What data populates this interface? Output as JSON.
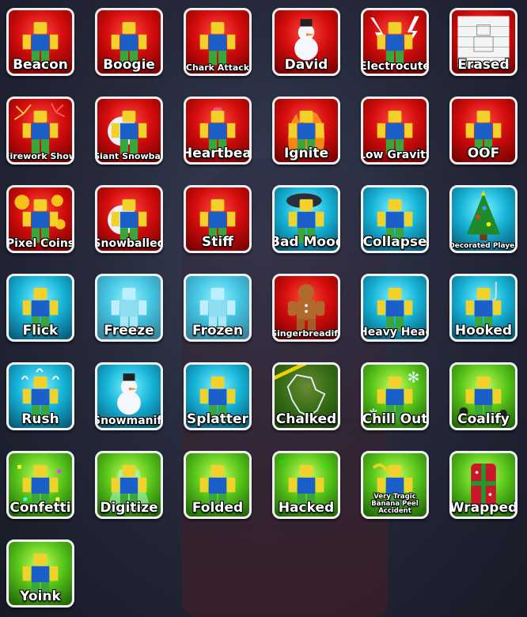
{
  "emotes": [
    {
      "name": "Beacon",
      "tier": "red",
      "icon": "beacon-icon"
    },
    {
      "name": "Boogie",
      "tier": "red",
      "icon": "boogie-icon"
    },
    {
      "name": "Chark Attack",
      "tier": "red",
      "icon": "chark-attack-icon"
    },
    {
      "name": "David",
      "tier": "red",
      "icon": "snowman-icon"
    },
    {
      "name": "Electrocute",
      "tier": "red",
      "icon": "electrocute-icon"
    },
    {
      "name": "Erased",
      "tier": "red",
      "icon": "erased-icon"
    },
    {
      "name": "Firework Show",
      "tier": "red",
      "icon": "firework-icon"
    },
    {
      "name": "Giant Snowball",
      "tier": "red",
      "icon": "giant-snowball-icon"
    },
    {
      "name": "Heartbeat",
      "tier": "red",
      "icon": "heartbeat-icon"
    },
    {
      "name": "Ignite",
      "tier": "red",
      "icon": "fire-icon"
    },
    {
      "name": "Low Gravity",
      "tier": "red",
      "icon": "low-gravity-icon"
    },
    {
      "name": "OOF",
      "tier": "red",
      "icon": "oof-icon"
    },
    {
      "name": "Pixel Coins",
      "tier": "red",
      "icon": "coins-icon"
    },
    {
      "name": "Snowballed",
      "tier": "red",
      "icon": "snowballed-icon"
    },
    {
      "name": "Stiff",
      "tier": "red",
      "icon": "stiff-icon"
    },
    {
      "name": "Bad Mood",
      "tier": "blue",
      "icon": "storm-cloud-icon"
    },
    {
      "name": "Collapse",
      "tier": "blue",
      "icon": "collapse-icon"
    },
    {
      "name": "Decorated Player",
      "tier": "blue",
      "icon": "christmas-tree-icon"
    },
    {
      "name": "Flick",
      "tier": "blue",
      "icon": "flick-icon"
    },
    {
      "name": "Freeze",
      "tier": "blue",
      "icon": "freeze-icon"
    },
    {
      "name": "Frozen",
      "tier": "blue",
      "icon": "frozen-icon"
    },
    {
      "name": "Gingerbreadify",
      "tier": "red",
      "icon": "gingerbread-icon"
    },
    {
      "name": "Heavy Head",
      "tier": "blue",
      "icon": "heavy-head-icon"
    },
    {
      "name": "Hooked",
      "tier": "blue",
      "icon": "hook-icon"
    },
    {
      "name": "Rush",
      "tier": "blue",
      "icon": "rush-icon"
    },
    {
      "name": "Snowmanify",
      "tier": "blue",
      "icon": "snowmanify-icon"
    },
    {
      "name": "Splatter",
      "tier": "blue",
      "icon": "splatter-icon"
    },
    {
      "name": "Chalked",
      "tier": "green",
      "icon": "chalk-outline-icon"
    },
    {
      "name": "Chill Out",
      "tier": "green",
      "icon": "snowflake-icon"
    },
    {
      "name": "Coalify",
      "tier": "green",
      "icon": "coal-icon"
    },
    {
      "name": "Confetti",
      "tier": "green",
      "icon": "confetti-icon"
    },
    {
      "name": "Digitize",
      "tier": "green",
      "icon": "digitize-icon"
    },
    {
      "name": "Folded",
      "tier": "green",
      "icon": "folded-icon"
    },
    {
      "name": "Hacked",
      "tier": "green",
      "icon": "hacked-icon"
    },
    {
      "name": "Very Tragic Banana Peel Accident",
      "tier": "green",
      "icon": "banana-peel-icon"
    },
    {
      "name": "Wrapped",
      "tier": "green",
      "icon": "gift-wrap-icon"
    },
    {
      "name": "Yoink",
      "tier": "green",
      "icon": "yoink-icon"
    }
  ],
  "tier_colors": {
    "red": "#d20c0c",
    "blue": "#16b3d8",
    "green": "#57c51a",
    "border": "#f2f2f2"
  }
}
